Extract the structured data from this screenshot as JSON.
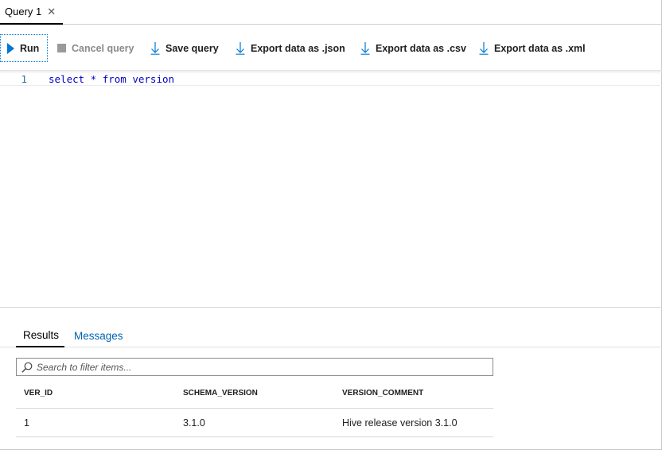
{
  "tab": {
    "label": "Query 1",
    "close_glyph": "✕"
  },
  "toolbar": {
    "run_label": "Run",
    "cancel_label": "Cancel query",
    "save_label": "Save query",
    "export_json_label": "Export data as .json",
    "export_csv_label": "Export data as .csv",
    "export_xml_label": "Export data as .xml"
  },
  "editor": {
    "lines": [
      {
        "number": "1",
        "text": "select * from version"
      }
    ]
  },
  "results": {
    "tabs": {
      "results": "Results",
      "messages": "Messages"
    },
    "filter_placeholder": "Search to filter items...",
    "columns": [
      "VER_ID",
      "SCHEMA_VERSION",
      "VERSION_COMMENT"
    ],
    "rows": [
      [
        "1",
        "3.1.0",
        "Hive release version 3.1.0"
      ]
    ]
  },
  "colors": {
    "accent": "#0078d4",
    "link": "#0063b1",
    "code_keyword": "#0000c8",
    "line_number": "#237893",
    "disabled": "#8a8a8a"
  },
  "icons": {
    "run": "play-icon",
    "cancel": "stop-icon",
    "save": "download-arrow-icon",
    "export": "download-arrow-icon",
    "filter": "search-icon"
  }
}
